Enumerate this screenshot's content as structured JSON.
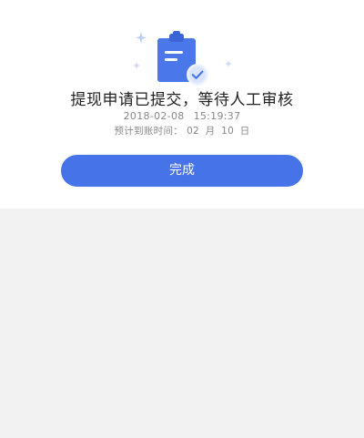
{
  "result": {
    "title": "提现申请已提交，等待人工审核",
    "submitted_date": "2018-02-08",
    "submitted_time": "15:19:37",
    "eta_label": "预计到账时间：",
    "eta_value": "02 月 10 日",
    "done_label": "完成"
  },
  "colors": {
    "accent": "#4673e8",
    "clipboard": "#4a78eb",
    "background": "#f2f2f2",
    "card": "#ffffff"
  },
  "icons": {
    "illustration": "clipboard-check-icon",
    "sparkles": "sparkle-icon"
  }
}
